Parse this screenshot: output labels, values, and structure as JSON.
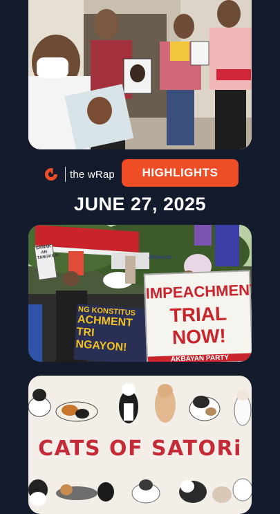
{
  "brand": {
    "wordmark": "the wRap"
  },
  "highlights_label": "HIGHLIGHTS",
  "date": "JUNE 27, 2025",
  "card2": {
    "sign_line1": "IMPEACHMENT",
    "sign_line2": "TRIAL NOW!",
    "banner_lines": [
      "NG KONSTITUS",
      "ACHMENT TRI",
      "NGAYON!"
    ],
    "small_sign": "SAMAK AN TANGKILIK",
    "akbayan": "Akbayan",
    "akbayan_banner": "AKBAYAN PARTY"
  },
  "card3": {
    "title": "CATS OF SATORi"
  },
  "colors": {
    "background": "#131b2c",
    "accent": "#ef4d25",
    "cats_title": "#c42a37",
    "sign_text": "#c9232b"
  },
  "icons": [
    "rappler-logo-icon"
  ]
}
